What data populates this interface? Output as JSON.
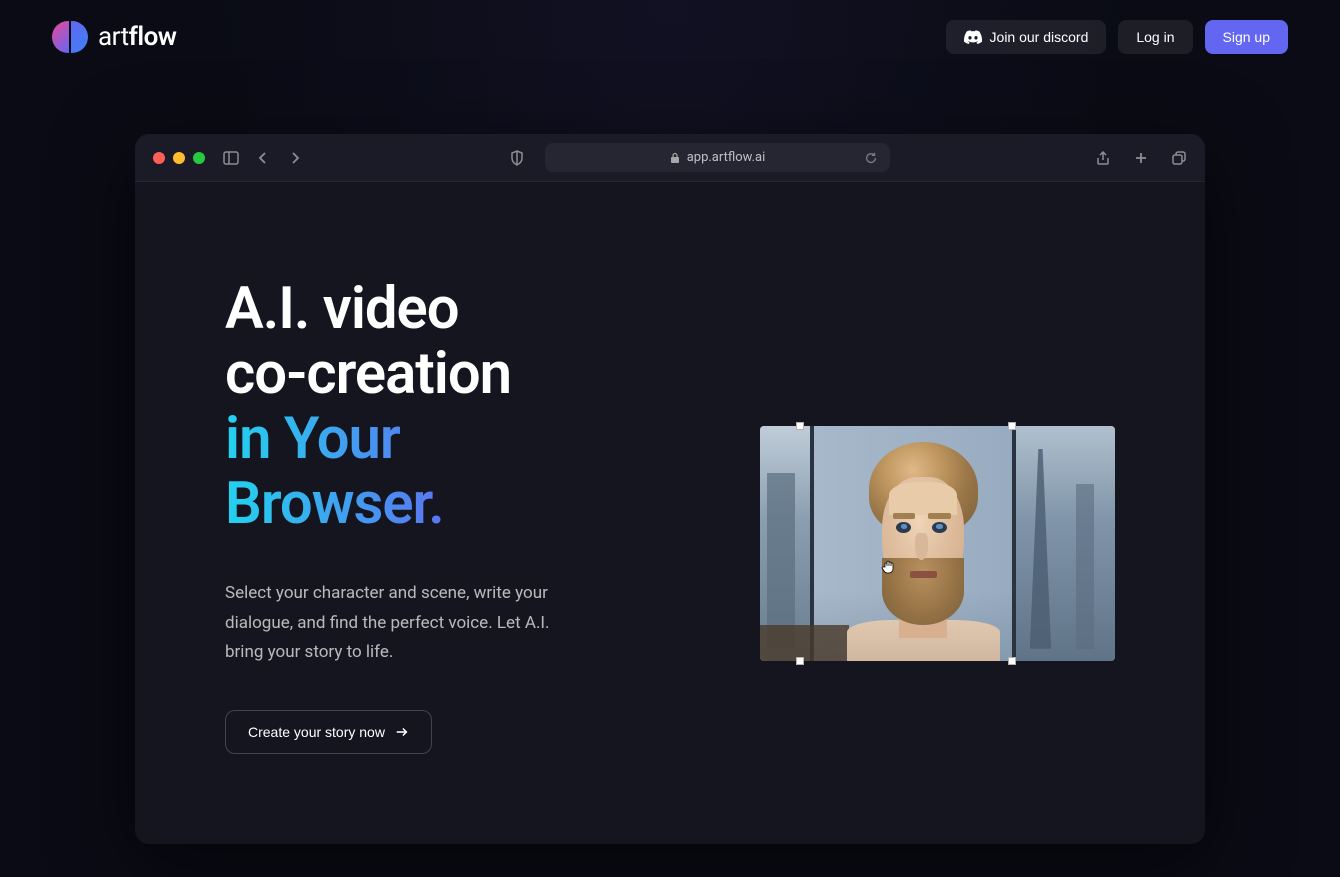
{
  "brand": {
    "name_part1": "art",
    "name_part2": "flow"
  },
  "header": {
    "discord_label": "Join our discord",
    "login_label": "Log in",
    "signup_label": "Sign up"
  },
  "browser": {
    "url": "app.artflow.ai"
  },
  "hero": {
    "title_line1": "A.I. video",
    "title_line2": "co-creation",
    "title_gradient_line1": "in Your",
    "title_gradient_line2": "Browser.",
    "subtitle": "Select your character and scene, write your dialogue, and find the perfect voice. Let A.I. bring your story to life.",
    "cta_label": "Create your story now"
  }
}
